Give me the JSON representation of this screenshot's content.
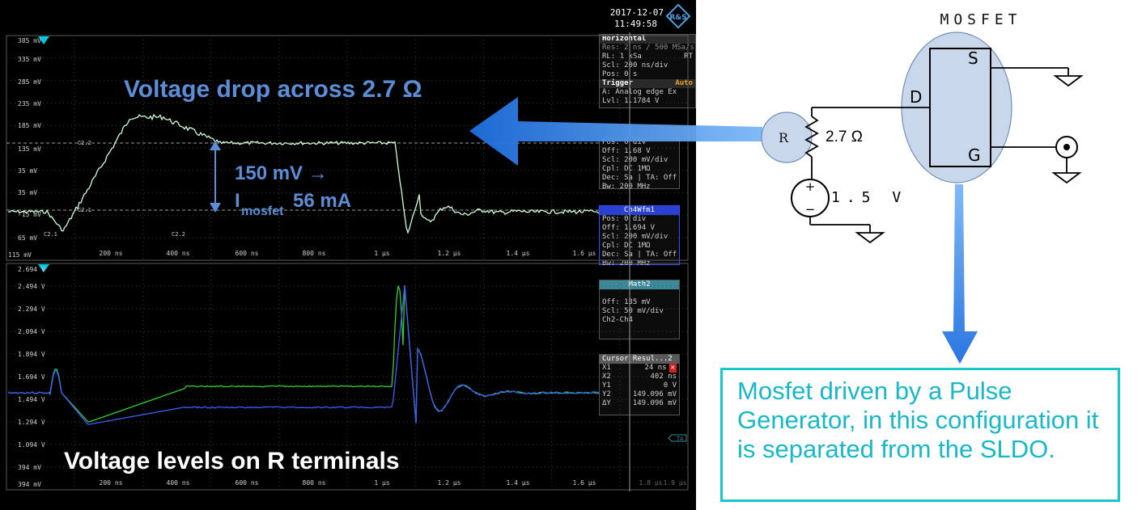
{
  "scope": {
    "date": "2017-12-07",
    "time": "11:49:58",
    "logo": "R&S",
    "upper_y_labels": [
      "385 mV",
      "335 mV",
      "285 mV",
      "235 mV",
      "185 mV",
      "135 mV",
      "35 mV",
      "35 mV",
      "-15 mV",
      "65 mV",
      "115 mV"
    ],
    "lower_y_labels": [
      "2.694 V",
      "2.494 V",
      "2.294 V",
      "2.094 V",
      "1.894 V",
      "1.694 V",
      "1.494 V",
      "1.294 V",
      "1.094 V",
      "394 mV",
      "394 mV"
    ],
    "x_labels": [
      "200 ns",
      "400 ns",
      "600 ns",
      "800 ns",
      "1 µs",
      "1.2 µs",
      "1.4 µs",
      "1.6 µs"
    ],
    "x_labels_extra": [
      "1.8 µs",
      "1.9 µs"
    ],
    "cursor_labels": {
      "c2_2_top": "C2.2",
      "c2_1_mid": "C2.1",
      "c2_1_low": "C2.1",
      "c2_2_low": "C2.2"
    },
    "horizontal": {
      "title": "Horizontal",
      "res": "Res: 2 ns / 500 MSa/s",
      "rl_label": "RL:",
      "rl": "1 kSa",
      "rt": "RT",
      "scl_label": "Scl:",
      "scl": "200 ns/div",
      "pos_label": "Pos:",
      "pos": "0 s",
      "trigger_title": "Trigger",
      "trigger_mode": "Auto",
      "a_label": "A:",
      "a": "Analog edge",
      "a_extra": "Ex",
      "lvl_label": "Lvl:",
      "lvl": "1.1784 V"
    },
    "ch_upper": {
      "pos": "Pos: 0 div",
      "off": "Off: 1.68 V",
      "scl": "Scl: 200 mV/div",
      "cpl": "Cpl: DC 1MΩ",
      "dec": "Dec: Sa | TA: Off",
      "bw": "Bw: 200 MHz"
    },
    "ch4": {
      "title": "Ch4Wfm1",
      "pos": "Pos: 0 div",
      "off": "Off: 1.694 V",
      "scl": "Scl: 200 mV/div",
      "cpl": "Cpl: DC 1MΩ",
      "dec": "Dec: Sa | TA: Off",
      "bw": "Bw: 200 MHz"
    },
    "math2": {
      "title": "Math2",
      "off": "Off: 135 mV",
      "scl": "Scl: 50 mV/div",
      "expr": "Ch2-Ch4"
    },
    "cursor": {
      "title": "Cursor Resul...2",
      "rows": [
        {
          "k": "X1",
          "v": "24 ns"
        },
        {
          "k": "X2",
          "v": "402 ns"
        },
        {
          "k": "Y1",
          "v": "0 V"
        },
        {
          "k": "Y2",
          "v": "149.096 mV"
        },
        {
          "k": "ΔY",
          "v": "149.096 mV"
        }
      ]
    },
    "ta_label": "TA"
  },
  "annotations": {
    "voltage_drop": "Voltage drop across 2.7 Ω",
    "mv_line": "150 mV →",
    "i_line_main": "I",
    "i_line_sub": "mosfet",
    "i_line_value": "56 mA",
    "voltage_levels": "Voltage levels on R terminals"
  },
  "circuit": {
    "mosfet_label": "MOSFET",
    "d_label": "D",
    "s_label": "S",
    "g_label": "G",
    "r_label": "R",
    "r_value": "2.7 Ω",
    "source_value": "1.5 V",
    "plus": "+",
    "minus": "−"
  },
  "note": "Mosfet driven by a Pulse Generator, in this configuration it is separated from the SLDO.",
  "colors": {
    "annotation_blue": "#5b8ed6",
    "trace_upper": "#d0ffd8",
    "trace_green": "#2fcf2f",
    "trace_blue": "#3a5cff",
    "note_cyan": "#19b8c8"
  }
}
